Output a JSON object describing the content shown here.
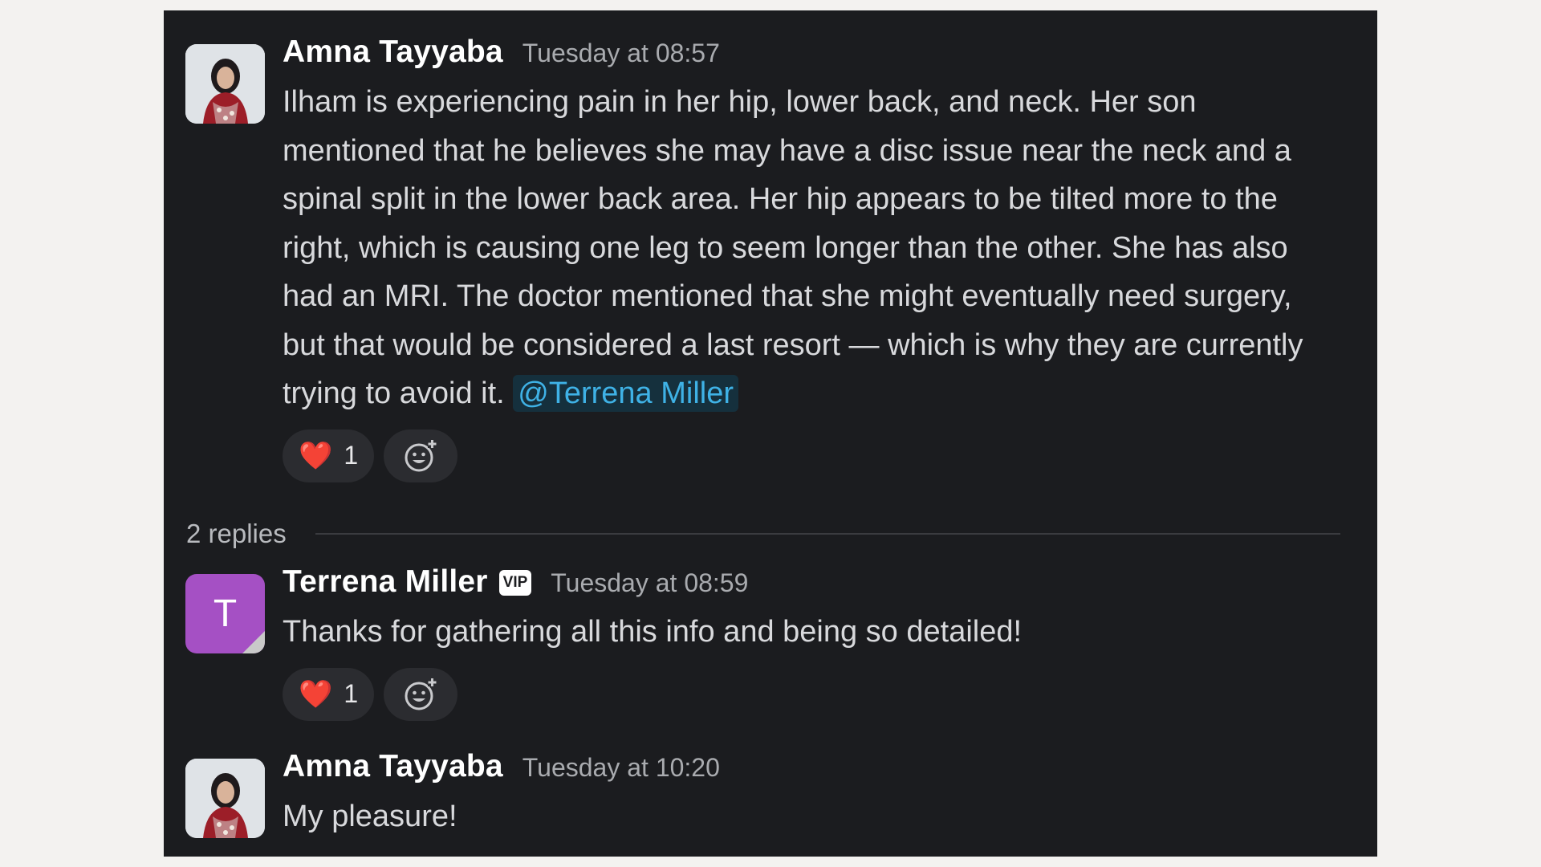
{
  "thread": {
    "messages": [
      {
        "author": "Amna Tayyaba",
        "timestamp": "Tuesday at 08:57",
        "avatar": "photo-avatar",
        "text": "Ilham is experiencing pain in her hip, lower back, and neck. Her son mentioned that he believes she may have a disc issue near the neck and a spinal split in the lower back area. Her hip appears to be tilted more to the right, which is causing one leg to seem longer than the other. She has also had an MRI. The doctor mentioned that she might eventually need surgery, but that would be considered a last resort — which is why they are currently trying to avoid it.",
        "mention": "@Terrena Miller",
        "reaction": {
          "emoji": "❤️",
          "count": "1"
        }
      },
      {
        "author": "Terrena Miller",
        "badge": "VIP",
        "timestamp": "Tuesday at 08:59",
        "avatar_letter": "T",
        "avatar_color": "#a550c4",
        "text": "Thanks for gathering all this info and being so detailed!",
        "reaction": {
          "emoji": "❤️",
          "count": "1"
        }
      },
      {
        "author": "Amna Tayyaba",
        "timestamp": "Tuesday at 10:20",
        "avatar": "photo-avatar",
        "text": "My pleasure!"
      }
    ],
    "replies_label": "2 replies"
  },
  "colors": {
    "panel_bg": "#1b1c1f",
    "mention": "#3fb2e6",
    "heart": "#e2232b",
    "page_bg": "#f3f2f0"
  },
  "icons": {
    "add_reaction": "add-reaction-icon",
    "heart": "heart-icon"
  }
}
